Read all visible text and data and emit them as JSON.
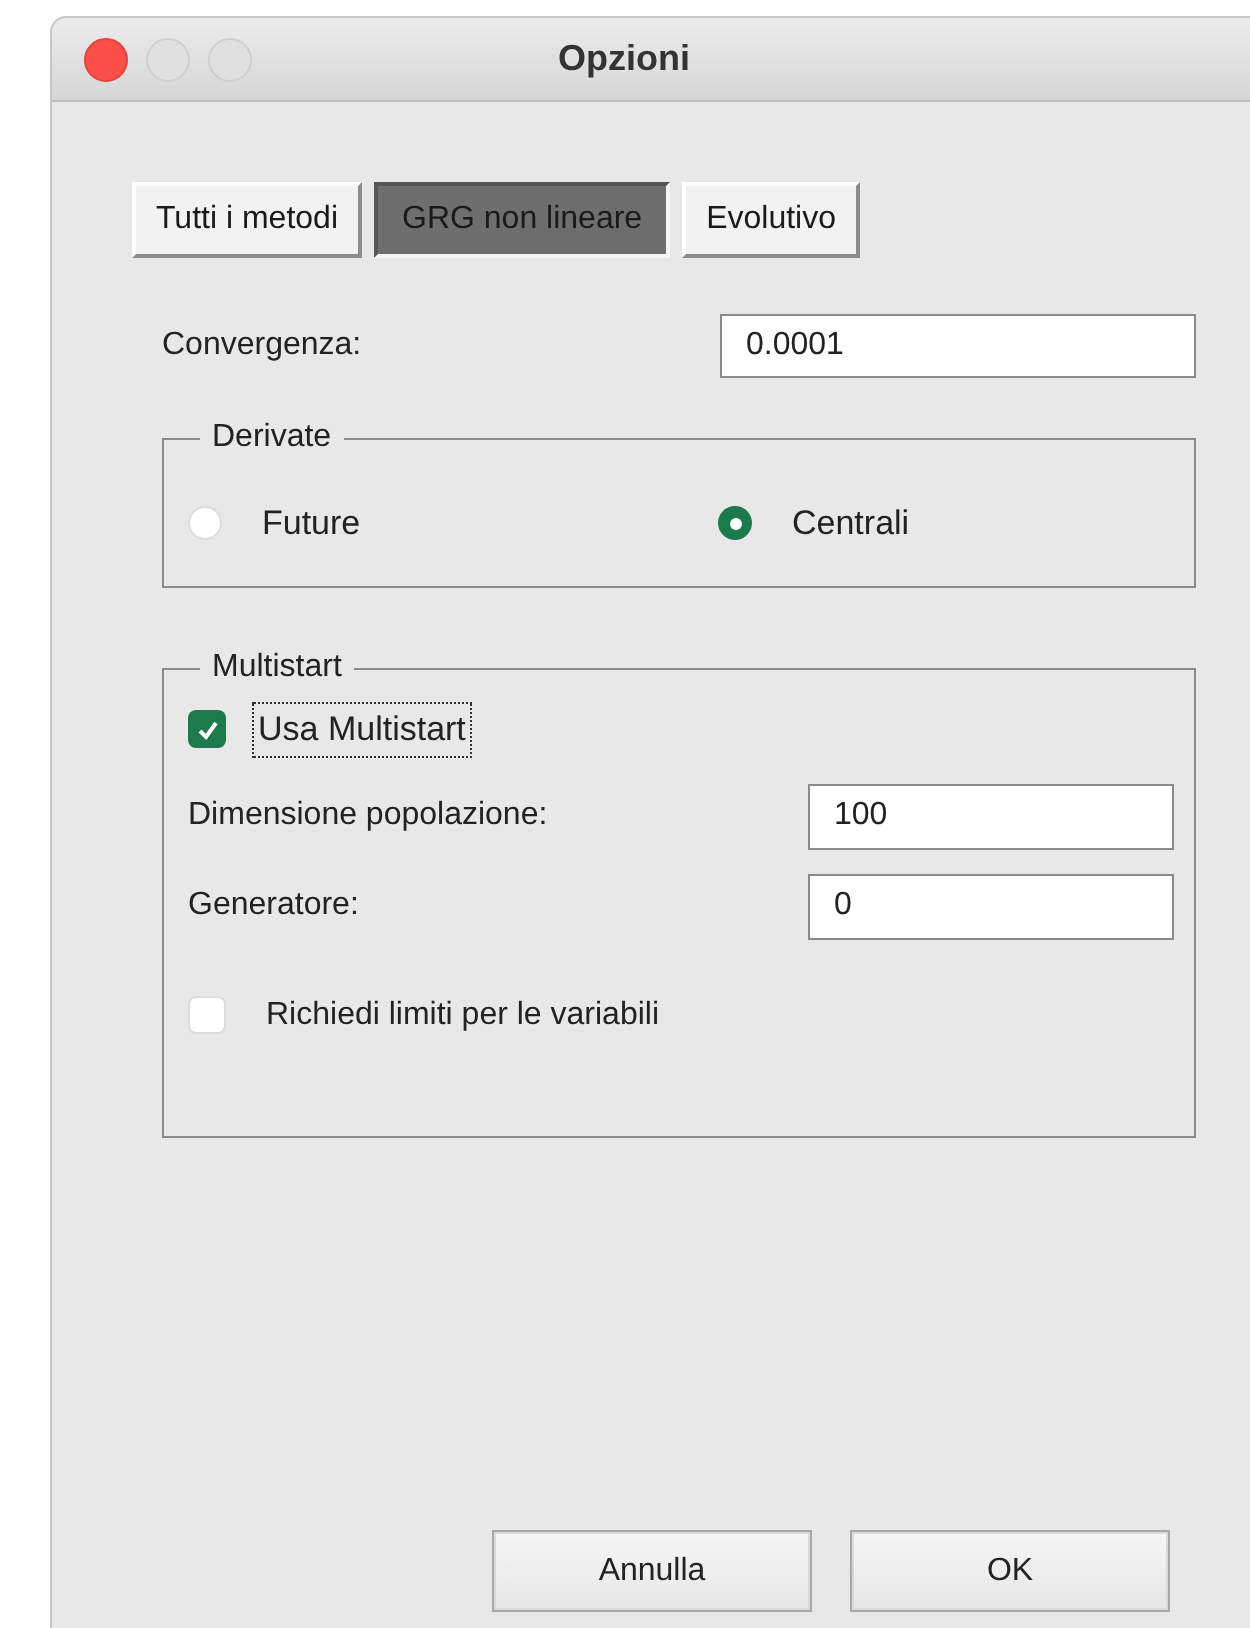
{
  "window": {
    "title": "Opzioni"
  },
  "tabs": [
    {
      "label": "Tutti i metodi",
      "selected": false
    },
    {
      "label": "GRG non lineare",
      "selected": true
    },
    {
      "label": "Evolutivo",
      "selected": false
    }
  ],
  "convergence": {
    "label": "Convergenza:",
    "value": "0.0001"
  },
  "derivatives": {
    "title": "Derivate",
    "options": [
      {
        "label": "Future",
        "selected": false
      },
      {
        "label": "Centrali",
        "selected": true
      }
    ]
  },
  "multistart": {
    "title": "Multistart",
    "use_multistart": {
      "label": "Usa Multistart",
      "checked": true,
      "focused": true
    },
    "fields": [
      {
        "label": "Dimensione popolazione:",
        "value": "100"
      },
      {
        "label": "Generatore:",
        "value": "0"
      }
    ],
    "require_bounds": {
      "label": "Richiedi limiti per le variabili",
      "checked": false
    }
  },
  "buttons": [
    "Annulla",
    "OK"
  ]
}
